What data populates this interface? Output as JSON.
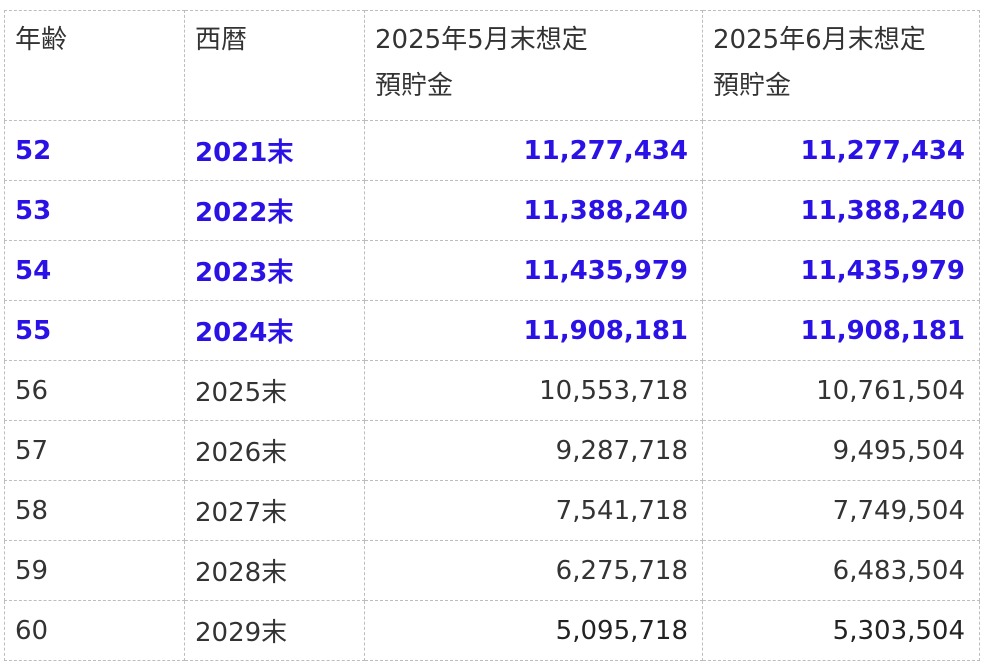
{
  "table": {
    "headers": {
      "age": "年齢",
      "year": "西暦",
      "may": [
        "2025年5月末想定",
        "預貯金"
      ],
      "jun": [
        "2025年6月末想定",
        "預貯金"
      ]
    },
    "rows": [
      {
        "age": "52",
        "year": "2021末",
        "may": "11,277,434",
        "jun": "11,277,434",
        "highlight": true
      },
      {
        "age": "53",
        "year": "2022末",
        "may": "11,388,240",
        "jun": "11,388,240",
        "highlight": true
      },
      {
        "age": "54",
        "year": "2023末",
        "may": "11,435,979",
        "jun": "11,435,979",
        "highlight": true
      },
      {
        "age": "55",
        "year": "2024末",
        "may": "11,908,181",
        "jun": "11,908,181",
        "highlight": true
      },
      {
        "age": "56",
        "year": "2025末",
        "may": "10,553,718",
        "jun": "10,761,504",
        "highlight": false
      },
      {
        "age": "57",
        "year": "2026末",
        "may": "9,287,718",
        "jun": "9,495,504",
        "highlight": false
      },
      {
        "age": "58",
        "year": "2027末",
        "may": "7,541,718",
        "jun": "7,749,504",
        "highlight": false
      },
      {
        "age": "59",
        "year": "2028末",
        "may": "6,275,718",
        "jun": "6,483,504",
        "highlight": false
      },
      {
        "age": "60",
        "year": "2029末",
        "may": "5,095,718",
        "jun": "5,303,504",
        "highlight": false,
        "bold_values": true
      }
    ]
  },
  "colors": {
    "highlight_text": "#2a12e6",
    "normal_text": "#333333",
    "border": "#bdbdbd"
  }
}
